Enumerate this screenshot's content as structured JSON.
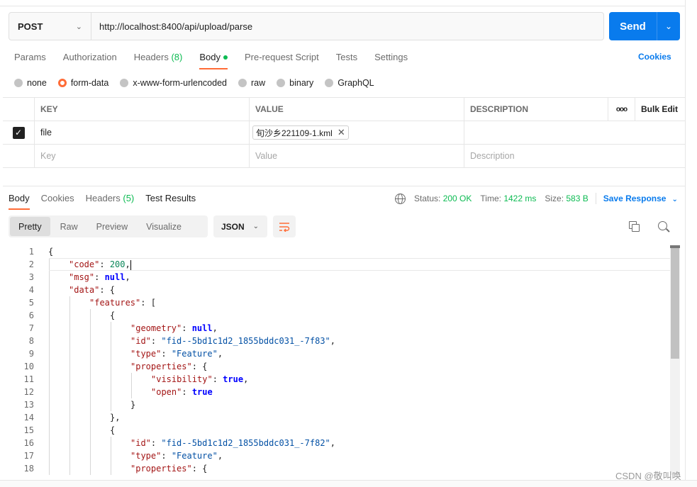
{
  "request": {
    "method": "POST",
    "url": "http://localhost:8400/api/upload/parse",
    "send_label": "Send"
  },
  "request_tabs": [
    {
      "label": "Params"
    },
    {
      "label": "Authorization"
    },
    {
      "label": "Headers",
      "count": "(8)"
    },
    {
      "label": "Body",
      "active": true
    },
    {
      "label": "Pre-request Script"
    },
    {
      "label": "Tests"
    },
    {
      "label": "Settings"
    }
  ],
  "cookies_label": "Cookies",
  "body_types": [
    {
      "label": "none"
    },
    {
      "label": "form-data",
      "selected": true
    },
    {
      "label": "x-www-form-urlencoded"
    },
    {
      "label": "raw"
    },
    {
      "label": "binary"
    },
    {
      "label": "GraphQL"
    }
  ],
  "form_table": {
    "headers": {
      "key": "KEY",
      "value": "VALUE",
      "description": "DESCRIPTION",
      "more": "ooo",
      "bulk_edit": "Bulk Edit"
    },
    "rows": [
      {
        "checked": true,
        "key": "file",
        "value_file": "旬沙乡221109-1.kml",
        "description": ""
      }
    ],
    "placeholders": {
      "key": "Key",
      "value": "Value",
      "description": "Description"
    }
  },
  "response_tabs": [
    {
      "label": "Body",
      "active": true
    },
    {
      "label": "Cookies"
    },
    {
      "label": "Headers",
      "count": "(5)"
    },
    {
      "label": "Test Results"
    }
  ],
  "response_status": {
    "status_label": "Status:",
    "status_value": "200 OK",
    "time_label": "Time:",
    "time_value": "1422 ms",
    "size_label": "Size:",
    "size_value": "583 B",
    "save_label": "Save Response"
  },
  "format_tabs": [
    {
      "label": "Pretty",
      "active": true
    },
    {
      "label": "Raw"
    },
    {
      "label": "Preview"
    },
    {
      "label": "Visualize"
    }
  ],
  "format_select": "JSON",
  "code_lines": [
    {
      "n": "1",
      "indent": 0,
      "parts": [
        [
          "p",
          "{"
        ]
      ]
    },
    {
      "n": "2",
      "indent": 1,
      "parts": [
        [
          "k",
          "\"code\""
        ],
        [
          "p",
          ": "
        ],
        [
          "n",
          "200"
        ],
        [
          "p",
          ","
        ]
      ]
    },
    {
      "n": "3",
      "indent": 1,
      "parts": [
        [
          "k",
          "\"msg\""
        ],
        [
          "p",
          ": "
        ],
        [
          "kw",
          "null"
        ],
        [
          "p",
          ","
        ]
      ]
    },
    {
      "n": "4",
      "indent": 1,
      "parts": [
        [
          "k",
          "\"data\""
        ],
        [
          "p",
          ": {"
        ]
      ]
    },
    {
      "n": "5",
      "indent": 2,
      "parts": [
        [
          "k",
          "\"features\""
        ],
        [
          "p",
          ": ["
        ]
      ]
    },
    {
      "n": "6",
      "indent": 3,
      "parts": [
        [
          "p",
          "{"
        ]
      ]
    },
    {
      "n": "7",
      "indent": 4,
      "parts": [
        [
          "k",
          "\"geometry\""
        ],
        [
          "p",
          ": "
        ],
        [
          "kw",
          "null"
        ],
        [
          "p",
          ","
        ]
      ]
    },
    {
      "n": "8",
      "indent": 4,
      "parts": [
        [
          "k",
          "\"id\""
        ],
        [
          "p",
          ": "
        ],
        [
          "s",
          "\"fid--5bd1c1d2_1855bddc031_-7f83\""
        ],
        [
          "p",
          ","
        ]
      ]
    },
    {
      "n": "9",
      "indent": 4,
      "parts": [
        [
          "k",
          "\"type\""
        ],
        [
          "p",
          ": "
        ],
        [
          "s",
          "\"Feature\""
        ],
        [
          "p",
          ","
        ]
      ]
    },
    {
      "n": "10",
      "indent": 4,
      "parts": [
        [
          "k",
          "\"properties\""
        ],
        [
          "p",
          ": {"
        ]
      ]
    },
    {
      "n": "11",
      "indent": 5,
      "parts": [
        [
          "k",
          "\"visibility\""
        ],
        [
          "p",
          ": "
        ],
        [
          "kw",
          "true"
        ],
        [
          "p",
          ","
        ]
      ]
    },
    {
      "n": "12",
      "indent": 5,
      "parts": [
        [
          "k",
          "\"open\""
        ],
        [
          "p",
          ": "
        ],
        [
          "kw",
          "true"
        ]
      ]
    },
    {
      "n": "13",
      "indent": 4,
      "parts": [
        [
          "p",
          "}"
        ]
      ]
    },
    {
      "n": "14",
      "indent": 3,
      "parts": [
        [
          "p",
          "},"
        ]
      ]
    },
    {
      "n": "15",
      "indent": 3,
      "parts": [
        [
          "p",
          "{"
        ]
      ]
    },
    {
      "n": "16",
      "indent": 4,
      "parts": [
        [
          "k",
          "\"id\""
        ],
        [
          "p",
          ": "
        ],
        [
          "s",
          "\"fid--5bd1c1d2_1855bddc031_-7f82\""
        ],
        [
          "p",
          ","
        ]
      ]
    },
    {
      "n": "17",
      "indent": 4,
      "parts": [
        [
          "k",
          "\"type\""
        ],
        [
          "p",
          ": "
        ],
        [
          "s",
          "\"Feature\""
        ],
        [
          "p",
          ","
        ]
      ]
    },
    {
      "n": "18",
      "indent": 4,
      "parts": [
        [
          "k",
          "\"properties\""
        ],
        [
          "p",
          ": {"
        ]
      ]
    }
  ],
  "watermark": "CSDN @敬叫唤"
}
